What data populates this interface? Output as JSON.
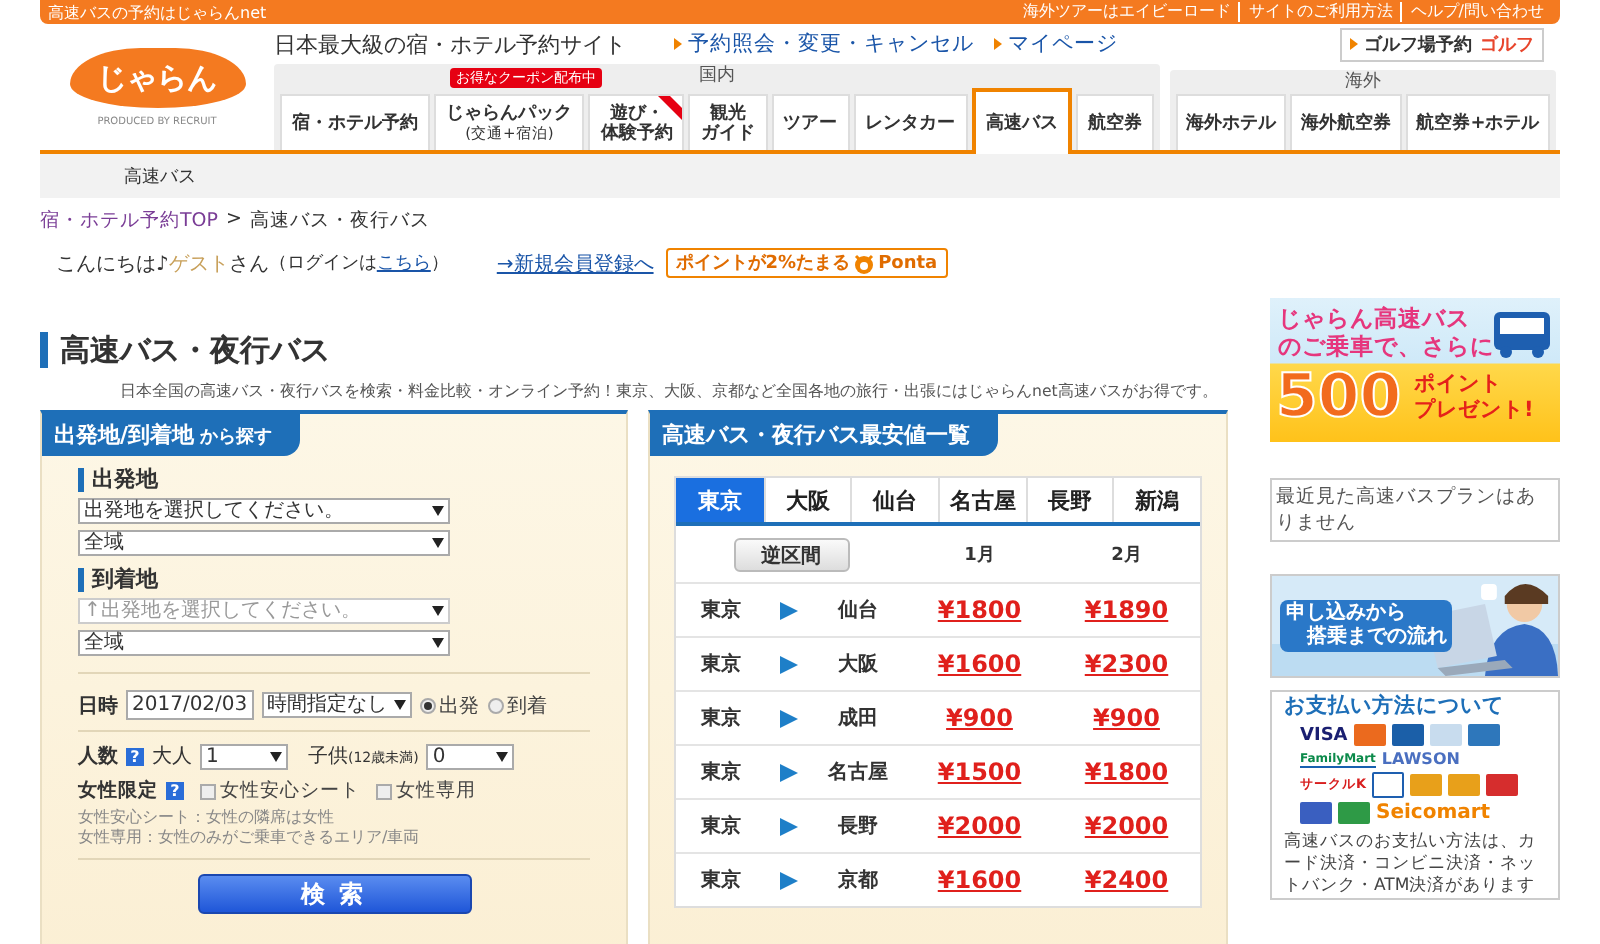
{
  "top_bar": {
    "tagline": "高速バスの予約はじゃらんnet",
    "links": [
      "海外ツアーはエイビーロード",
      "サイトのご利用方法",
      "ヘルプ/問い合わせ"
    ]
  },
  "header": {
    "logo": "じゃらん",
    "logo_credit": "PRODUCED BY RECRUIT",
    "site_tagline": "日本最大級の宿・ホテル予約サイト",
    "links": [
      "予約照会・変更・キャンセル",
      "マイページ"
    ],
    "golf_button": {
      "label": "ゴルフ場予約",
      "logo": "ゴルフ"
    }
  },
  "nav_groups": [
    {
      "title": "国内",
      "tabs": [
        {
          "lines": [
            "宿・ホテル予約"
          ],
          "selected": false
        },
        {
          "lines": [
            "じゃらんパック"
          ],
          "note": "(交通+宿泊)",
          "badge": "お得なクーポン配布中",
          "selected": false
        },
        {
          "lines": [
            "遊び・",
            "体験予約"
          ],
          "corner_ribbon": true,
          "selected": false
        },
        {
          "lines": [
            "観光",
            "ガイド"
          ],
          "selected": false
        },
        {
          "lines": [
            "ツアー"
          ],
          "selected": false
        },
        {
          "lines": [
            "レンタカー"
          ],
          "selected": false
        },
        {
          "lines": [
            "高速バス"
          ],
          "selected": true
        },
        {
          "lines": [
            "航空券"
          ],
          "selected": false
        }
      ]
    },
    {
      "title": "海外",
      "tabs": [
        {
          "lines": [
            "海外ホテル"
          ],
          "selected": false
        },
        {
          "lines": [
            "海外航空券"
          ],
          "selected": false
        },
        {
          "lines": [
            "航空券+ホテル"
          ],
          "selected": false
        }
      ]
    }
  ],
  "subnav": {
    "items": [
      "高速バス"
    ]
  },
  "breadcrumb": {
    "items": [
      {
        "label": "宿・ホテル予約TOP",
        "link": true
      },
      {
        "label": "高速バス・夜行バス",
        "link": false
      }
    ],
    "separator": ">"
  },
  "greeting": {
    "hello": "こんにちは♪",
    "guest": "ゲスト",
    "suffix": "さん",
    "login_prefix": "（ログインは",
    "login_link": "こちら",
    "login_suffix": "）",
    "register_link": "→新規会員登録へ",
    "ponta_badge": {
      "label": "ポイントが2%たまる",
      "brand": "Ponta"
    }
  },
  "page_title": "高速バス・夜行バス",
  "intro": "日本全国の高速バス・夜行バスを検索・料金比較・オンライン予約！東京、大阪、京都など全国各地の旅行・出張にはじゃらんnet高速バスがお得です。",
  "search_panel": {
    "title": "出発地/到着地",
    "title_suffix": "から探す",
    "departure": {
      "label": "出発地",
      "selects": [
        {
          "value": "出発地を選択してください。",
          "disabled": false
        },
        {
          "value": "全域",
          "disabled": false
        }
      ]
    },
    "arrival": {
      "label": "到着地",
      "selects": [
        {
          "value": "↑出発地を選択してください。",
          "disabled": true
        },
        {
          "value": "全域",
          "disabled": false
        }
      ]
    },
    "date": {
      "label": "日時",
      "value": "2017/02/03",
      "time": "時間指定なし",
      "options": [
        {
          "label": "出発",
          "selected": true
        },
        {
          "label": "到着",
          "selected": false
        }
      ]
    },
    "people": {
      "label": "人数",
      "help": "?",
      "adults_label": "大人",
      "adults": "1",
      "children_label": "子供",
      "children_note": "(12歳未満)",
      "children": "0"
    },
    "women": {
      "label": "女性限定",
      "help": "?",
      "options": [
        {
          "label": "女性安心シート",
          "checked": false
        },
        {
          "label": "女性専用",
          "checked": false
        }
      ],
      "notes": [
        "女性安心シート：女性の隣席は女性",
        "女性専用：女性のみがご乗車できるエリア/車両"
      ]
    },
    "search_button": "検 索"
  },
  "fares": {
    "title": "高速バス・夜行バス最安値一覧",
    "cities": [
      {
        "label": "東京",
        "selected": true
      },
      {
        "label": "大阪",
        "selected": false
      },
      {
        "label": "仙台",
        "selected": false
      },
      {
        "label": "名古屋",
        "selected": false
      },
      {
        "label": "長野",
        "selected": false
      },
      {
        "label": "新潟",
        "selected": false
      }
    ],
    "reverse_button": "逆区間",
    "months": [
      "1月",
      "2月"
    ],
    "rows": [
      {
        "from": "東京",
        "to": "仙台",
        "prices": [
          "¥1800",
          "¥1890"
        ]
      },
      {
        "from": "東京",
        "to": "大阪",
        "prices": [
          "¥1600",
          "¥2300"
        ]
      },
      {
        "from": "東京",
        "to": "成田",
        "prices": [
          "¥900",
          "¥900"
        ]
      },
      {
        "from": "東京",
        "to": "名古屋",
        "prices": [
          "¥1500",
          "¥1800"
        ]
      },
      {
        "from": "東京",
        "to": "長野",
        "prices": [
          "¥2000",
          "¥2000"
        ]
      },
      {
        "from": "東京",
        "to": "京都",
        "prices": [
          "¥1600",
          "¥2400"
        ]
      }
    ]
  },
  "sidebar": {
    "promo_banner": {
      "lines": [
        "じゃらん高速バス",
        "のご乗車で、さらに"
      ],
      "points": "500",
      "points_label": [
        "ポイント",
        "プレゼント!"
      ]
    },
    "recent": "最近見た高速バスプランはありません",
    "flow_banner": {
      "lines": [
        "申し込みから",
        "搭乗までの流れ"
      ]
    },
    "payment": {
      "title": "お支払い方法について",
      "logos": [
        "VISA",
        "FamilyMart",
        "LAWSON",
        "サークルK",
        "Seicomart"
      ],
      "text": "高速バスのお支払い方法は、カード決済・コンビニ決済・ネットバンク・ATM決済があります"
    }
  }
}
